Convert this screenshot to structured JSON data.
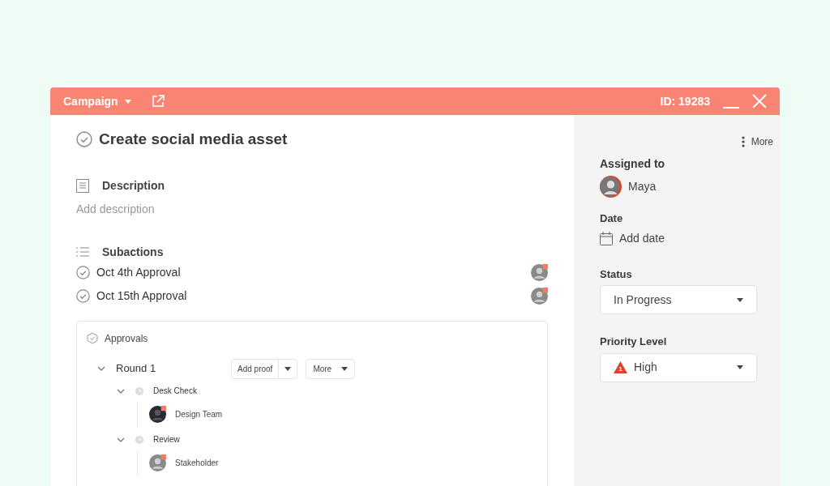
{
  "header": {
    "project": "Campaign",
    "id": "ID: 19283"
  },
  "task": {
    "title": "Create social media asset",
    "done": false
  },
  "description": {
    "label": "Description",
    "placeholder": "Add description"
  },
  "subactions": {
    "label": "Subactions",
    "items": [
      {
        "name": "Oct 4th Approval",
        "done": false
      },
      {
        "name": "Oct 15th Approval",
        "done": false
      }
    ]
  },
  "approvals": {
    "label": "Approvals",
    "rounds": [
      {
        "name": "Round 1",
        "expanded": true,
        "add_button": "Add proof",
        "more_button": "More",
        "children": [
          {
            "name": "Desk Check",
            "expanded": true,
            "children": [
              {
                "name": "Design Team"
              }
            ]
          },
          {
            "name": "Review",
            "expanded": true,
            "children": [
              {
                "name": "Stakeholder"
              }
            ]
          }
        ]
      }
    ]
  },
  "sidebar": {
    "more": "More",
    "assigned_label": "Assigned to",
    "assignee": "Maya",
    "date_label": "Date",
    "date_placeholder": "Add date",
    "status_label": "Status",
    "status": "In Progress",
    "priority_label": "Priority Level",
    "priority": "High",
    "priority_badge": "1"
  }
}
